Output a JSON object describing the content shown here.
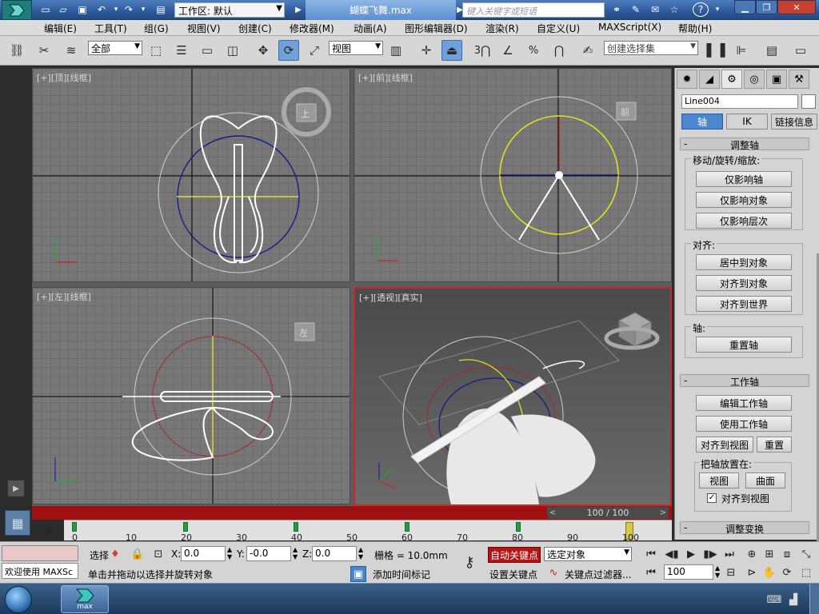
{
  "title_bar": {
    "workspace_label": "工作区: 默认",
    "doc_title": "蝴蝶飞舞.max",
    "search_placeholder": "键入关键字或短语",
    "help_glyph": "?"
  },
  "menu": {
    "items": [
      "编辑(E)",
      "工具(T)",
      "组(G)",
      "视图(V)",
      "创建(C)",
      "修改器(M)",
      "动画(A)",
      "图形编辑器(D)",
      "渲染(R)",
      "自定义(U)",
      "MAXScript(X)",
      "帮助(H)"
    ]
  },
  "toolbar": {
    "filter_value": "全部",
    "ref_coord_value": "视图",
    "selection_set_placeholder": "创建选择集",
    "snap_labels": [
      "3",
      "%"
    ]
  },
  "viewports": {
    "top": "[+][顶][线框]",
    "front": "[+][前][线框]",
    "left": "[+][左][线框]",
    "persp": "[+][透视][真实]",
    "cube_labels": {
      "top": "上",
      "front": "前",
      "left": "左"
    }
  },
  "command_panel": {
    "object_name": "Line004",
    "color": "#ffffff",
    "subtabs": [
      "轴",
      "IK",
      "链接信息"
    ],
    "adjust_pivot": {
      "title": "调整轴",
      "group_move": "移动/旋转/缩放:",
      "btn_pivot_only": "仅影响轴",
      "btn_object_only": "仅影响对象",
      "btn_hierarchy_only": "仅影响层次",
      "group_align": "对齐:",
      "btn_center": "居中到对象",
      "btn_align_obj": "对齐到对象",
      "btn_align_world": "对齐到世界",
      "group_pivot": "轴:",
      "btn_reset_pivot": "重置轴"
    },
    "working_pivot": {
      "title": "工作轴",
      "btn_edit": "编辑工作轴",
      "btn_use": "使用工作轴",
      "btn_align_view": "对齐到视图",
      "btn_reset": "重置",
      "group_place": "把轴放置在:",
      "btn_view": "视图",
      "btn_surface": "曲面",
      "chk_align_view": "对齐到视图",
      "chk_checked": true
    },
    "adjust_transform": {
      "title": "调整变换"
    }
  },
  "timeline": {
    "slider_text": "100 / 100",
    "tick_labels": [
      "0",
      "10",
      "20",
      "30",
      "40",
      "50",
      "60",
      "70",
      "80",
      "90",
      "100"
    ]
  },
  "status": {
    "welcome": "欢迎使用 MAXSc",
    "selected": "选择",
    "x_label": "X:",
    "x_value": "0.0",
    "y_label": "Y:",
    "y_value": "-0.0",
    "z_label": "Z:",
    "z_value": "0.0",
    "grid": "栅格 = 10.0mm",
    "prompt": "单击并拖动以选择并旋转对象",
    "add_time_tag": "添加时间标记",
    "auto_key": "自动关键点",
    "set_key": "设置关键点",
    "key_mode_value": "选定对象",
    "key_filters": "关键点过滤器...",
    "frame_value": "100"
  },
  "taskbar": {
    "app_label": "max"
  }
}
